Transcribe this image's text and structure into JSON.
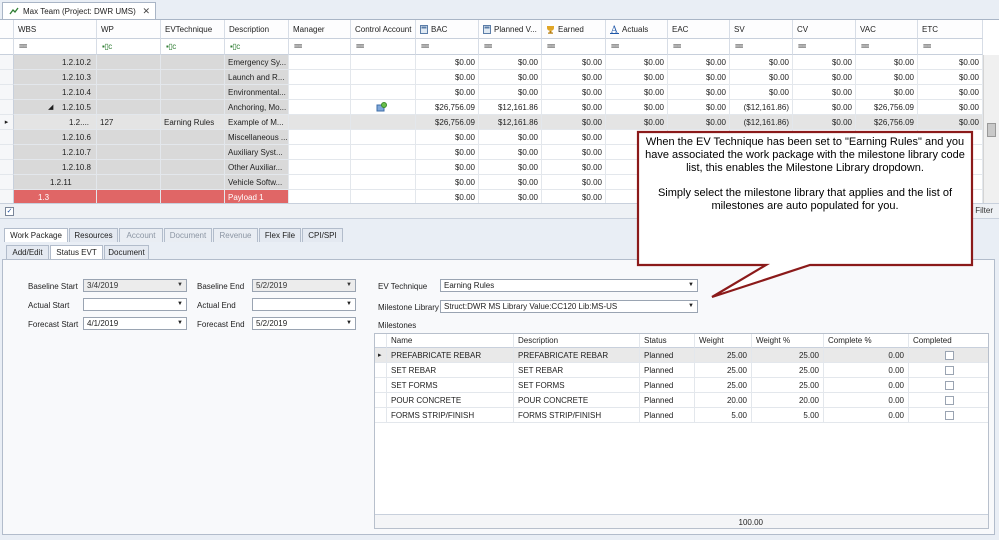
{
  "window": {
    "tab_title": "Max Team (Project: DWR UMS)",
    "close_glyph": "✕"
  },
  "grid": {
    "columns": [
      {
        "label": "WBS",
        "icon": "",
        "filter": "="
      },
      {
        "label": "WP",
        "icon": "",
        "filter": "flag"
      },
      {
        "label": "EVTechnique",
        "icon": "",
        "filter": "flag"
      },
      {
        "label": "Description",
        "icon": "",
        "filter": "flag"
      },
      {
        "label": "Manager",
        "icon": "",
        "filter": "="
      },
      {
        "label": "Control Account",
        "icon": "",
        "filter": "="
      },
      {
        "label": "BAC",
        "icon": "calc-icon",
        "filter": "="
      },
      {
        "label": "Planned V...",
        "icon": "calc-icon",
        "filter": "="
      },
      {
        "label": "Earned",
        "icon": "trophy-icon",
        "filter": "="
      },
      {
        "label": "Actuals",
        "icon": "a-letter-icon",
        "filter": "="
      },
      {
        "label": "EAC",
        "icon": "",
        "filter": "="
      },
      {
        "label": "SV",
        "icon": "",
        "filter": "="
      },
      {
        "label": "CV",
        "icon": "",
        "filter": "="
      },
      {
        "label": "VAC",
        "icon": "",
        "filter": "="
      },
      {
        "label": "ETC",
        "icon": "",
        "filter": "="
      }
    ],
    "filter_flag_text": "▪▯c",
    "filter_eq_text": "==",
    "rows": [
      {
        "indicator": "",
        "expander": "",
        "wbs": "1.2.10.2",
        "wp": "",
        "ev": "",
        "desc": "Emergency Sy...",
        "mgr": "",
        "ca": "",
        "bac": "$0.00",
        "pv": "$0.00",
        "earned": "$0.00",
        "actuals": "$0.00",
        "eac": "$0.00",
        "sv": "$0.00",
        "cv": "$0.00",
        "vac": "$0.00",
        "etc": "$0.00",
        "style": "gray"
      },
      {
        "indicator": "",
        "expander": "",
        "wbs": "1.2.10.3",
        "wp": "",
        "ev": "",
        "desc": "Launch and R...",
        "mgr": "",
        "ca": "",
        "bac": "$0.00",
        "pv": "$0.00",
        "earned": "$0.00",
        "actuals": "$0.00",
        "eac": "$0.00",
        "sv": "$0.00",
        "cv": "$0.00",
        "vac": "$0.00",
        "etc": "$0.00",
        "style": "gray"
      },
      {
        "indicator": "",
        "expander": "",
        "wbs": "1.2.10.4",
        "wp": "",
        "ev": "",
        "desc": "Environmental...",
        "mgr": "",
        "ca": "",
        "bac": "$0.00",
        "pv": "$0.00",
        "earned": "$0.00",
        "actuals": "$0.00",
        "eac": "$0.00",
        "sv": "$0.00",
        "cv": "$0.00",
        "vac": "$0.00",
        "etc": "$0.00",
        "style": "gray"
      },
      {
        "indicator": "",
        "expander": "◢",
        "wbs": "1.2.10.5",
        "wp": "",
        "ev": "",
        "desc": "Anchoring, Mo...",
        "mgr": "",
        "ca": "ca-icon",
        "bac": "$26,756.09",
        "pv": "$12,161.86",
        "earned": "$0.00",
        "actuals": "$0.00",
        "eac": "$0.00",
        "sv": "($12,161.86)",
        "cv": "$0.00",
        "vac": "$26,756.09",
        "etc": "$0.00",
        "style": "gray"
      },
      {
        "indicator": "▸",
        "expander": "",
        "wbs": "1.2....",
        "wp": "127",
        "ev": "Earning Rules",
        "desc": "Example of M...",
        "mgr": "",
        "ca": "",
        "bac": "$26,756.09",
        "pv": "$12,161.86",
        "earned": "$0.00",
        "actuals": "$0.00",
        "eac": "$0.00",
        "sv": "($12,161.86)",
        "cv": "$0.00",
        "vac": "$26,756.09",
        "etc": "$0.00",
        "style": "selected"
      },
      {
        "indicator": "",
        "expander": "",
        "wbs": "1.2.10.6",
        "wp": "",
        "ev": "",
        "desc": "Miscellaneous ...",
        "mgr": "",
        "ca": "",
        "bac": "$0.00",
        "pv": "$0.00",
        "earned": "$0.00",
        "actuals": "$0.00",
        "eac": "",
        "sv": "",
        "cv": "",
        "vac": "",
        "etc": "",
        "style": "gray"
      },
      {
        "indicator": "",
        "expander": "",
        "wbs": "1.2.10.7",
        "wp": "",
        "ev": "",
        "desc": "Auxiliary Syst...",
        "mgr": "",
        "ca": "",
        "bac": "$0.00",
        "pv": "$0.00",
        "earned": "$0.00",
        "actuals": "$0.00",
        "eac": "",
        "sv": "",
        "cv": "",
        "vac": "",
        "etc": "",
        "style": "gray"
      },
      {
        "indicator": "",
        "expander": "",
        "wbs": "1.2.10.8",
        "wp": "",
        "ev": "",
        "desc": "Other Auxiliar...",
        "mgr": "",
        "ca": "",
        "bac": "$0.00",
        "pv": "$0.00",
        "earned": "$0.00",
        "actuals": "$0.00",
        "eac": "",
        "sv": "",
        "cv": "",
        "vac": "",
        "etc": "",
        "style": "gray"
      },
      {
        "indicator": "",
        "expander": "",
        "wbs": "1.2.11",
        "wp": "",
        "ev": "",
        "desc": "Vehicle Softw...",
        "mgr": "",
        "ca": "",
        "bac": "$0.00",
        "pv": "$0.00",
        "earned": "$0.00",
        "actuals": "$0.00",
        "eac": "",
        "sv": "",
        "cv": "",
        "vac": "",
        "etc": "",
        "style": "gray"
      },
      {
        "indicator": "",
        "expander": "",
        "wbs": "1.3",
        "wp": "",
        "ev": "",
        "desc": "Payload 1",
        "mgr": "",
        "ca": "",
        "bac": "$0.00",
        "pv": "$0.00",
        "earned": "$0.00",
        "actuals": "$0.00",
        "eac": "",
        "sv": "",
        "cv": "",
        "vac": "",
        "etc": "",
        "style": "red"
      }
    ]
  },
  "footer": {
    "filter_label": "Filter",
    "checkbox_glyph": "✓"
  },
  "tabs_main": [
    {
      "label": "Work Package",
      "state": "active"
    },
    {
      "label": "Resources",
      "state": "normal"
    },
    {
      "label": "Account",
      "state": "disabled"
    },
    {
      "label": "Document",
      "state": "disabled"
    },
    {
      "label": "Revenue",
      "state": "disabled"
    },
    {
      "label": "Flex File",
      "state": "normal"
    },
    {
      "label": "CPI/SPI",
      "state": "normal"
    }
  ],
  "tabs_sub": [
    {
      "label": "Add/Edit",
      "state": "normal"
    },
    {
      "label": "Status EVT",
      "state": "active"
    },
    {
      "label": "Document",
      "state": "normal"
    }
  ],
  "form": {
    "baseline_start_label": "Baseline Start",
    "baseline_start": "3/4/2019",
    "baseline_end_label": "Baseline End",
    "baseline_end": "5/2/2019",
    "actual_start_label": "Actual Start",
    "actual_start": "",
    "actual_end_label": "Actual End",
    "actual_end": "",
    "forecast_start_label": "Forecast Start",
    "forecast_start": "4/1/2019",
    "forecast_end_label": "Forecast End",
    "forecast_end": "5/2/2019",
    "ev_technique_label": "EV Technique",
    "ev_technique": "Earning Rules",
    "milestone_library_label": "Milestone Library",
    "milestone_library": "Struct:DWR MS Library Value:CC120 Lib:MS-US",
    "milestones_label": "Milestones",
    "dropdown_glyph": "▼"
  },
  "milestones": {
    "columns": [
      "Name",
      "Description",
      "Status",
      "Weight",
      "Weight %",
      "Complete %",
      "Completed"
    ],
    "rows": [
      {
        "indicator": "▸",
        "name": "PREFABRICATE REBAR",
        "desc": "PREFABRICATE REBAR",
        "status": "Planned",
        "weight": "25.00",
        "weight_pct": "25.00",
        "complete_pct": "0.00"
      },
      {
        "indicator": "",
        "name": "SET REBAR",
        "desc": "SET REBAR",
        "status": "Planned",
        "weight": "25.00",
        "weight_pct": "25.00",
        "complete_pct": "0.00"
      },
      {
        "indicator": "",
        "name": "SET FORMS",
        "desc": "SET FORMS",
        "status": "Planned",
        "weight": "25.00",
        "weight_pct": "25.00",
        "complete_pct": "0.00"
      },
      {
        "indicator": "",
        "name": "POUR CONCRETE",
        "desc": "POUR CONCRETE",
        "status": "Planned",
        "weight": "20.00",
        "weight_pct": "20.00",
        "complete_pct": "0.00"
      },
      {
        "indicator": "",
        "name": "FORMS STRIP/FINISH",
        "desc": "FORMS STRIP/FINISH",
        "status": "Planned",
        "weight": "5.00",
        "weight_pct": "5.00",
        "complete_pct": "0.00"
      }
    ],
    "total_weight": "100.00"
  },
  "callout": {
    "paragraph1": "When the EV Technique has been set to \"Earning Rules\" and you have associated the work package with the milestone library code list, this enables the Milestone Library dropdown.",
    "paragraph2": "Simply select the milestone library that applies and the list of milestones are auto populated for you."
  },
  "colors": {
    "callout_border": "#8b1a1a",
    "red_row": "#e06666",
    "gray_cell": "#d9d9d9"
  }
}
